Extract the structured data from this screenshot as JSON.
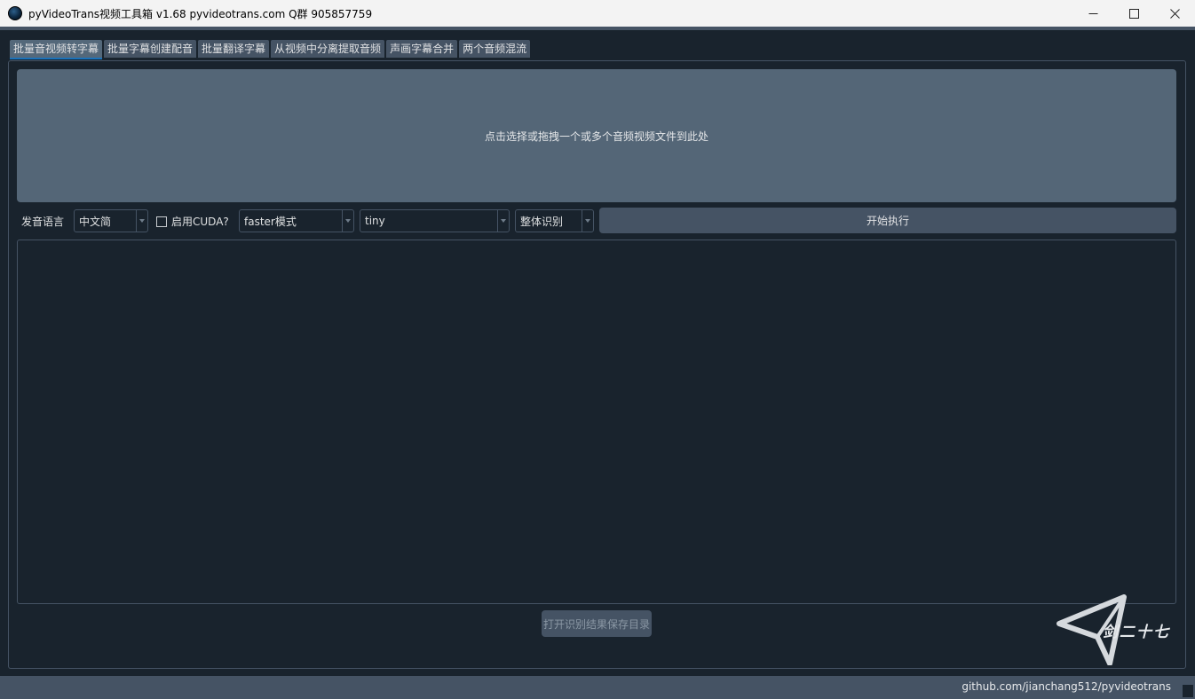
{
  "window": {
    "title": "pyVideoTrans视频工具箱 v1.68 pyvideotrans.com  Q群 905857759",
    "minimize_icon": "minimize-icon",
    "maximize_icon": "maximize-icon",
    "close_icon": "close-icon"
  },
  "tabs": [
    {
      "label": "批量音视频转字幕",
      "active": true
    },
    {
      "label": "批量字幕创建配音",
      "active": false
    },
    {
      "label": "批量翻译字幕",
      "active": false
    },
    {
      "label": "从视频中分离提取音频",
      "active": false
    },
    {
      "label": "声画字幕合并",
      "active": false
    },
    {
      "label": "两个音频混流",
      "active": false
    }
  ],
  "dropzone": {
    "text": "点击选择或拖拽一个或多个音频视频文件到此处"
  },
  "controls": {
    "language_label": "发音语言",
    "language_value": "中文简",
    "cuda_label": "启用CUDA?",
    "cuda_checked": false,
    "mode_value": "faster模式",
    "model_value": "tiny",
    "split_value": "整体识别",
    "start_button": "开始执行"
  },
  "output": {
    "text": ""
  },
  "open_dir_button": "打开识别结果保存目录",
  "logo": {
    "text": "剑二十七"
  },
  "status": {
    "link": "github.com/jianchang512/pyvideotrans"
  },
  "colors": {
    "background": "#19232d",
    "panel_border": "#455364",
    "dropzone": "#546677",
    "button": "#455364",
    "tab_active_underline": "#1a72bb"
  }
}
